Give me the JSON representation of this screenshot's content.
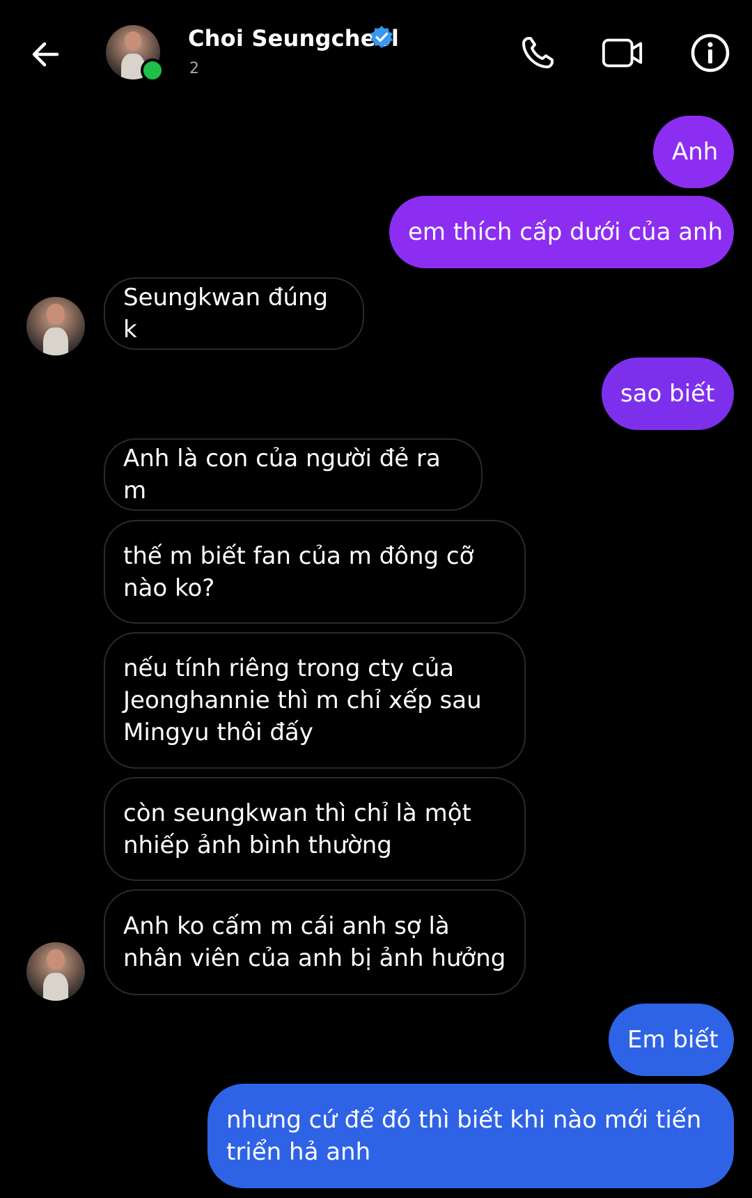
{
  "header": {
    "contact_name": "Choi Seungcheol",
    "subtitle": "2",
    "verified": true,
    "online": true,
    "back_icon": "arrow-left-icon",
    "actions": [
      {
        "icon": "phone-icon"
      },
      {
        "icon": "video-camera-icon"
      },
      {
        "icon": "info-icon"
      }
    ]
  },
  "colors": {
    "background": "#000000",
    "incoming_border": "#2b2b2b",
    "outgoing_purple": "#8c2ef2",
    "outgoing_violet": "#7d30ec",
    "outgoing_blue": "#2f63e6",
    "online_green": "#1fbf4a",
    "verified_blue": "#3897f0"
  },
  "messages": [
    {
      "from": "me",
      "text": "Anh"
    },
    {
      "from": "me",
      "text": "em thích cấp dưới của anh"
    },
    {
      "from": "them",
      "text": "Seungkwan đúng k"
    },
    {
      "from": "me",
      "text": "sao biết"
    },
    {
      "from": "them",
      "text": "Anh là con của người đẻ ra m"
    },
    {
      "from": "them",
      "text": "thế m biết fan của m đông cỡ nào ko?"
    },
    {
      "from": "them",
      "text": "nếu tính riêng trong cty của Jeonghannie thì m chỉ xếp sau Mingyu thôi đấy"
    },
    {
      "from": "them",
      "text": "còn seungkwan thì chỉ là một nhiếp ảnh bình thường"
    },
    {
      "from": "them",
      "text": "Anh ko cấm m cái anh sợ là nhân viên của anh bị ảnh hưởng"
    },
    {
      "from": "me",
      "text": "Em biết"
    },
    {
      "from": "me",
      "text": "nhưng cứ để đó thì biết khi nào mới tiến triển hả anh"
    }
  ]
}
